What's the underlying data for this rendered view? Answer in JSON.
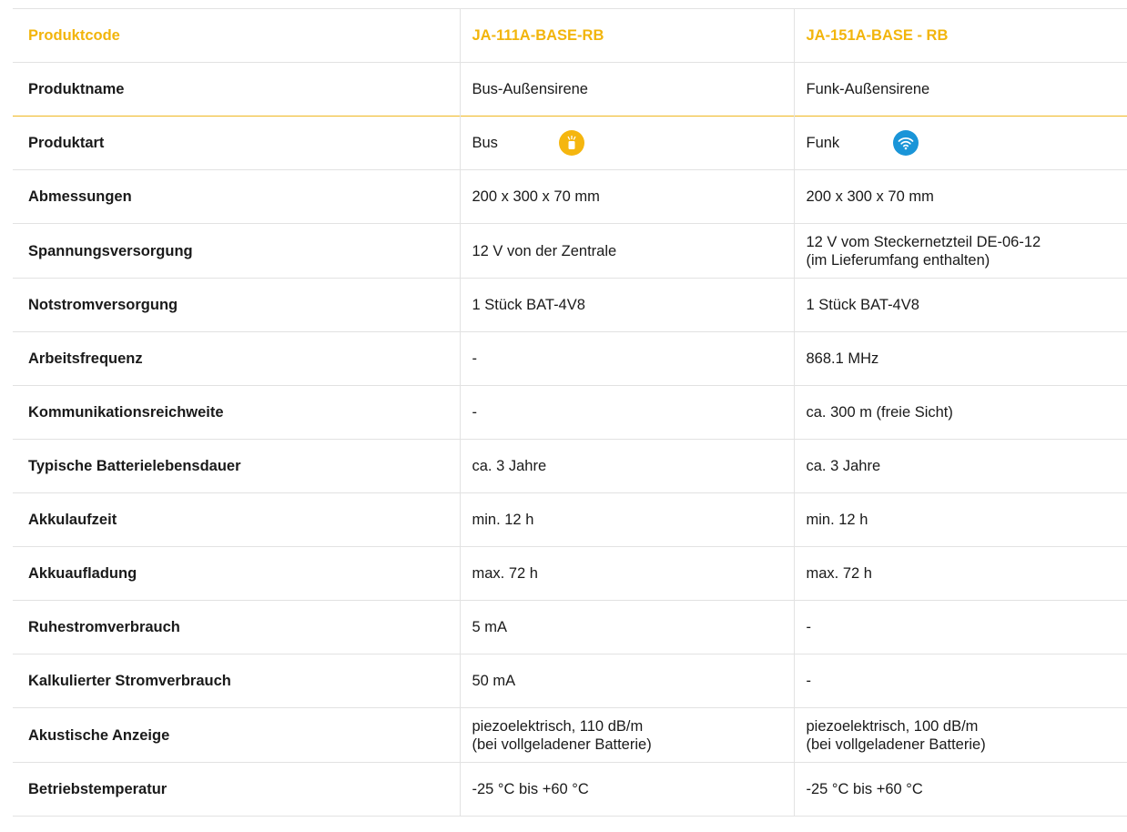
{
  "header": {
    "label": "Produktcode",
    "product1": "JA-111A-BASE-RB",
    "product2": "JA-151A-BASE - RB"
  },
  "rows": [
    {
      "label": "Produktname",
      "v1": "Bus-Außensirene",
      "v2": "Funk-Außensirene"
    },
    {
      "label": "Produktart",
      "v1": "Bus",
      "v2": "Funk"
    },
    {
      "label": "Abmessungen",
      "v1": "200 x 300 x 70 mm",
      "v2": "200 x 300 x 70 mm"
    },
    {
      "label": "Spannungsversorgung",
      "v1": "12 V von der Zentrale",
      "v2_line1": "12 V vom Steckernetzteil DE-06-12",
      "v2_line2": "(im Lieferumfang enthalten)"
    },
    {
      "label": "Notstromversorgung",
      "v1": "1 Stück BAT-4V8",
      "v2": "1 Stück BAT-4V8"
    },
    {
      "label": "Arbeitsfrequenz",
      "v1": "-",
      "v2": "868.1 MHz"
    },
    {
      "label": "Kommunikationsreichweite",
      "v1": "-",
      "v2": "ca. 300 m (freie Sicht)"
    },
    {
      "label": "Typische Batterielebensdauer",
      "v1": "ca. 3 Jahre",
      "v2": "ca. 3 Jahre"
    },
    {
      "label": "Akkulaufzeit",
      "v1": "min. 12 h",
      "v2": "min. 12 h"
    },
    {
      "label": "Akkuaufladung",
      "v1": "max. 72 h",
      "v2": "max. 72 h"
    },
    {
      "label": "Ruhestromverbrauch",
      "v1": "5 mA",
      "v2": "-"
    },
    {
      "label": "Kalkulierter Stromverbrauch",
      "v1": "50 mA",
      "v2": "-"
    },
    {
      "label": "Akustische Anzeige",
      "v1_line1": "piezoelektrisch, 110 dB/m",
      "v1_line2": "(bei vollgeladener Batterie)",
      "v2_line1": "piezoelektrisch, 100 dB/m",
      "v2_line2": "(bei vollgeladener Batterie)"
    },
    {
      "label": "Betriebstemperatur",
      "v1": "-25 °C bis +60 °C",
      "v2": "-25 °C bis +60 °C"
    }
  ],
  "icons": {
    "bus": "bus-icon",
    "funk": "wifi-icon"
  },
  "colors": {
    "accent": "#f2b50c",
    "bus_badge": "#f5b60f",
    "funk_badge": "#1a95d8"
  }
}
